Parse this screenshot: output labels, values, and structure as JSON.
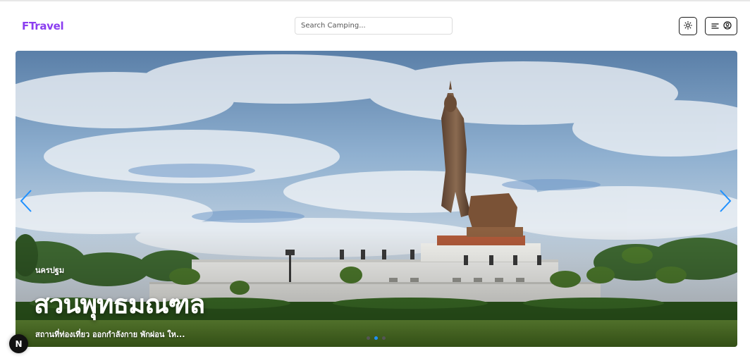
{
  "header": {
    "logo": "FTravel",
    "search_placeholder": "Search Camping..."
  },
  "hero": {
    "province": "นครปฐม",
    "title": "สวนพุทธมณฑล",
    "description": "สถานที่ท่องเที่ยว ออกกำลังกาย พักผ่อน ให...",
    "slides_count": 3,
    "active_slide_index": 1
  },
  "badge": {
    "label": "N"
  },
  "colors": {
    "brand": "#8b3df0",
    "arrow": "#1e90ff",
    "active_dot": "#1e90ff"
  }
}
